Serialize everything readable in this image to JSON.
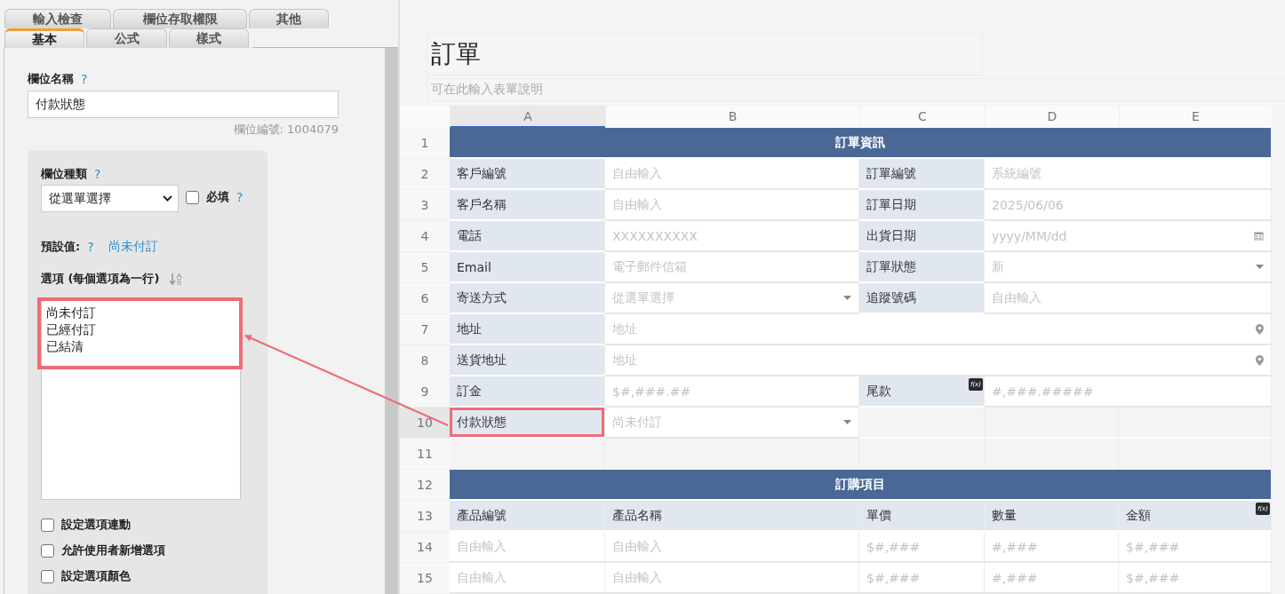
{
  "field_editor": {
    "tab_rows": [
      [
        {
          "label": "輸入檢查",
          "selected": false
        },
        {
          "label": "欄位存取權限",
          "selected": false
        },
        {
          "label": "其他",
          "selected": false
        }
      ],
      [
        {
          "label": "基本",
          "selected": true
        },
        {
          "label": "公式",
          "selected": false
        },
        {
          "label": "樣式",
          "selected": false
        }
      ]
    ],
    "field_name": {
      "label": "欄位名稱",
      "help": "?",
      "value": "付款狀態"
    },
    "field_id": "欄位編號: 1004079",
    "field_type": {
      "label": "欄位種類",
      "help": "?",
      "value": "從選單選擇"
    },
    "required": {
      "label": "必填",
      "help": "?",
      "checked": false
    },
    "default_value": {
      "label": "預設值:",
      "help": "?",
      "value": "尚未付訂"
    },
    "options": {
      "label": "選項 (每個選項為一行)",
      "lines": [
        "尚未付訂",
        "已經付訂",
        "已結清"
      ],
      "highlighted": true
    },
    "checkboxes": [
      {
        "label": "設定選項連動",
        "checked": false
      },
      {
        "label": "允許使用者新增選項",
        "checked": false
      },
      {
        "label": "設定選項顏色",
        "checked": false
      }
    ]
  },
  "sheet": {
    "title": "訂單",
    "description_placeholder": "可在此輸入表單說明",
    "columns": [
      {
        "label": "A",
        "selected": true
      },
      {
        "label": "B",
        "selected": false
      },
      {
        "label": "C",
        "selected": false
      },
      {
        "label": "D",
        "selected": false
      },
      {
        "label": "E",
        "selected": false
      }
    ],
    "rows": [
      {
        "number": "1",
        "selected": false,
        "cells": [
          {
            "kind": "section",
            "text": "訂單資訊"
          }
        ]
      },
      {
        "number": "2",
        "selected": false,
        "cells": [
          {
            "kind": "label",
            "text": "客戶編號"
          },
          {
            "kind": "input",
            "text": "自由輸入"
          },
          {
            "kind": "label",
            "text": "訂單編號"
          },
          {
            "kind": "wide_input",
            "text": "系統編號"
          }
        ]
      },
      {
        "number": "3",
        "selected": false,
        "cells": [
          {
            "kind": "label",
            "text": "客戶名稱"
          },
          {
            "kind": "input",
            "text": "自由輸入"
          },
          {
            "kind": "label",
            "text": "訂單日期"
          },
          {
            "kind": "wide_input",
            "text": "2025/06/06"
          }
        ]
      },
      {
        "number": "4",
        "selected": false,
        "cells": [
          {
            "kind": "label",
            "text": "電話"
          },
          {
            "kind": "input",
            "text": "XXXXXXXXXX"
          },
          {
            "kind": "label",
            "text": "出貨日期"
          },
          {
            "kind": "date",
            "text": "yyyy/MM/dd"
          }
        ]
      },
      {
        "number": "5",
        "selected": false,
        "cells": [
          {
            "kind": "label",
            "text": "Email"
          },
          {
            "kind": "input",
            "text": "電子郵件信箱"
          },
          {
            "kind": "label",
            "text": "訂單狀態"
          },
          {
            "kind": "wide_select",
            "text": "新"
          }
        ]
      },
      {
        "number": "6",
        "selected": false,
        "cells": [
          {
            "kind": "label",
            "text": "寄送方式"
          },
          {
            "kind": "select",
            "text": "從選單選擇"
          },
          {
            "kind": "label",
            "text": "追蹤號碼"
          },
          {
            "kind": "wide_input",
            "text": "自由輸入"
          }
        ]
      },
      {
        "number": "7",
        "selected": false,
        "cells": [
          {
            "kind": "label",
            "text": "地址"
          },
          {
            "kind": "address",
            "text": "地址"
          }
        ]
      },
      {
        "number": "8",
        "selected": false,
        "cells": [
          {
            "kind": "label",
            "text": "送貨地址"
          },
          {
            "kind": "address",
            "text": "地址"
          }
        ]
      },
      {
        "number": "9",
        "selected": false,
        "cells": [
          {
            "kind": "label",
            "text": "訂金"
          },
          {
            "kind": "input",
            "text": "$#,###.##"
          },
          {
            "kind": "label",
            "text": "尾款",
            "badge": "f(x)"
          },
          {
            "kind": "wide_input",
            "text": "#,###.#####"
          }
        ]
      },
      {
        "number": "10",
        "selected": true,
        "cells": [
          {
            "kind": "label",
            "text": "付款狀態",
            "highlighted": true
          },
          {
            "kind": "select",
            "text": "尚未付訂"
          },
          {
            "kind": "empty"
          },
          {
            "kind": "empty"
          },
          {
            "kind": "empty"
          }
        ]
      },
      {
        "number": "11",
        "selected": false,
        "cells": [
          {
            "kind": "empty"
          },
          {
            "kind": "empty"
          },
          {
            "kind": "empty"
          },
          {
            "kind": "empty"
          },
          {
            "kind": "empty"
          }
        ]
      },
      {
        "number": "12",
        "selected": false,
        "cells": [
          {
            "kind": "section",
            "text": "訂購項目"
          }
        ]
      },
      {
        "number": "13",
        "selected": false,
        "cells": [
          {
            "kind": "label",
            "text": "產品編號"
          },
          {
            "kind": "label",
            "text": "產品名稱"
          },
          {
            "kind": "label",
            "text": "單價"
          },
          {
            "kind": "label",
            "text": "數量"
          },
          {
            "kind": "label",
            "text": "金額",
            "badge": "f(x)"
          }
        ]
      },
      {
        "number": "14",
        "selected": false,
        "cells": [
          {
            "kind": "input",
            "text": "自由輸入"
          },
          {
            "kind": "input",
            "text": "自由輸入"
          },
          {
            "kind": "input",
            "text": "$#,###"
          },
          {
            "kind": "input",
            "text": "#,###"
          },
          {
            "kind": "input",
            "text": "$#,###"
          }
        ]
      },
      {
        "number": "15",
        "selected": false,
        "cells": [
          {
            "kind": "input",
            "text": "自由輸入"
          },
          {
            "kind": "input",
            "text": "自由輸入"
          },
          {
            "kind": "input",
            "text": "$#,###"
          },
          {
            "kind": "input",
            "text": "#,###"
          },
          {
            "kind": "input",
            "text": "$#,###"
          }
        ]
      }
    ]
  }
}
